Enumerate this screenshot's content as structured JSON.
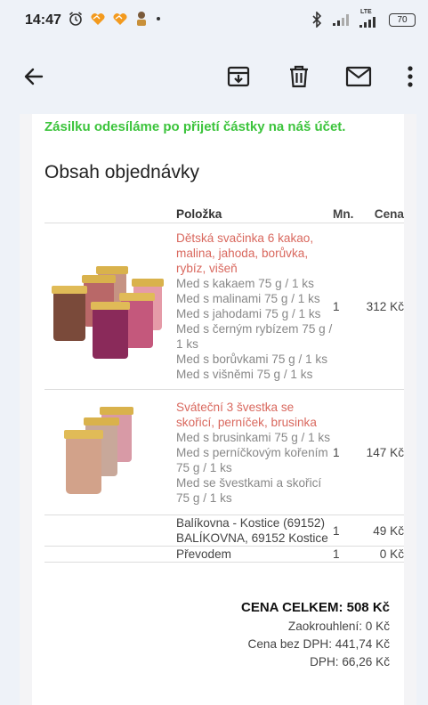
{
  "status": {
    "time": "14:47",
    "battery": "70",
    "lte": "LTE"
  },
  "notice": "Zásilku odesíláme po přijetí částky na náš účet.",
  "order": {
    "heading": "Obsah objednávky",
    "col_item": "Položka",
    "col_qty": "Mn.",
    "col_price": "Cena",
    "items": [
      {
        "name": "Dětská svačinka 6 kakao, malina, jahoda, borůvka, rybíz, višeň",
        "subs": [
          "Med s kakaem 75 g / 1 ks",
          "Med s malinami 75 g / 1 ks",
          "Med s jahodami 75 g / 1 ks",
          "Med s černým rybízem 75 g / 1 ks",
          "Med s borůvkami 75 g / 1 ks",
          "Med s višněmi 75 g / 1 ks"
        ],
        "qty": "1",
        "price": "312 Kč"
      },
      {
        "name": "Sváteční 3 švestka se skořicí, perníček, brusinka",
        "subs": [
          "Med s brusinkami 75 g / 1 ks",
          "Med s perníčkovým kořením 75 g / 1 ks",
          "Med se švestkami a skořicí 75 g / 1 ks"
        ],
        "qty": "1",
        "price": "147 Kč"
      }
    ],
    "shipping": {
      "line1": "Balíkovna - Kostice (69152)",
      "line2": "BALÍKOVNA, 69152 Kostice",
      "qty": "1",
      "price": "49 Kč"
    },
    "payment": {
      "label": "Převodem",
      "qty": "1",
      "price": "0 Kč"
    }
  },
  "totals": {
    "total": "CENA CELKEM: 508 Kč",
    "rounding": "Zaokrouhlení: 0 Kč",
    "without_vat": "Cena bez DPH: 441,74 Kč",
    "vat": "DPH: 66,26 Kč"
  },
  "icons": [
    "back-arrow-icon",
    "archive-icon",
    "delete-icon",
    "mail-icon",
    "more-vert-icon"
  ]
}
